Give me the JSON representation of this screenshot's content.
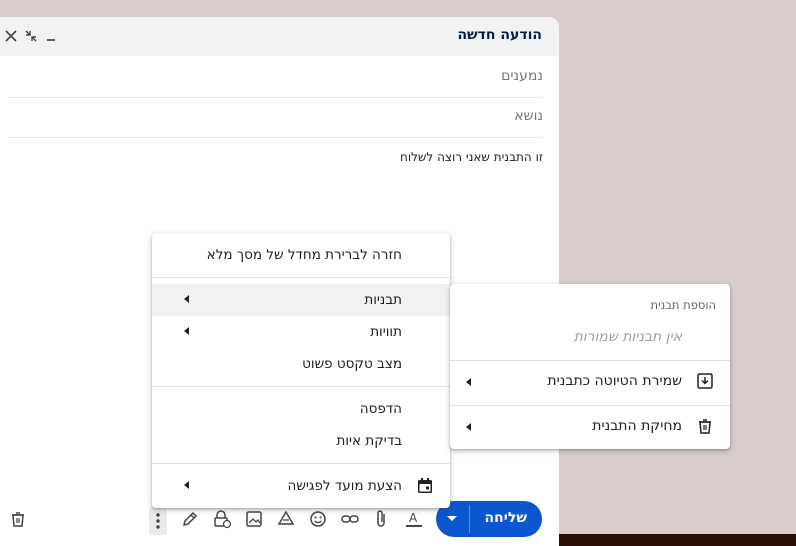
{
  "compose": {
    "title": "הודעה חדשה",
    "to_placeholder": "נמענים",
    "subject_placeholder": "נושא",
    "body_text": "זו התבנית שאני רוצה לשלוח"
  },
  "toolbar": {
    "send_label": "שליחה"
  },
  "more_menu": {
    "items": [
      {
        "label": "חזרה לברירת מחדל של מסך מלא"
      },
      {
        "label": "תבניות"
      },
      {
        "label": "תוויות"
      },
      {
        "label": "מצב טקסט פשוט"
      },
      {
        "label": "הדפסה"
      },
      {
        "label": "בדיקת איות"
      },
      {
        "label": "הצעת מועד לפגישה"
      }
    ]
  },
  "templates_menu": {
    "heading": "הוספת תבנית",
    "empty_text": "אין תבניות שמורות",
    "items": [
      {
        "label": "שמירת הטיוטה כתבנית"
      },
      {
        "label": "מחיקת התבנית"
      }
    ]
  },
  "colors": {
    "accent": "#0b57d0",
    "header_bg": "#f2f2f2",
    "desktop_bg": "#d8cdca"
  }
}
